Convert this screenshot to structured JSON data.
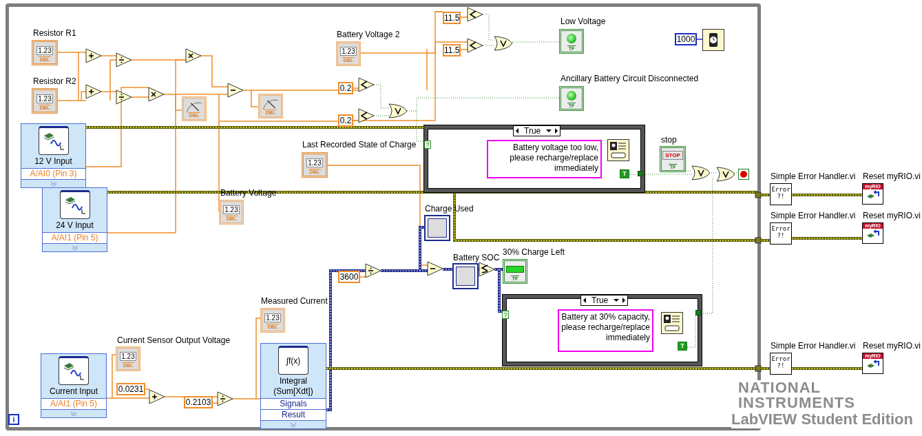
{
  "loop": {
    "iteration_terminal": "i"
  },
  "numeric_controls": [
    {
      "label": "Resistor R1",
      "value": "1.23",
      "type": "DBL"
    },
    {
      "label": "Resistor R2",
      "value": "1.23",
      "type": "DBL"
    },
    {
      "label": "Last Recorded State of Charge",
      "value": "1.23",
      "type": "DBL"
    }
  ],
  "numeric_indicators": [
    {
      "label": "Battery Voltage 2",
      "value": "1.23",
      "type": "DBL"
    },
    {
      "label": "Battery Voltage",
      "value": "1.23",
      "type": "DBL"
    },
    {
      "label": "Measured Current",
      "value": "1.23",
      "type": "DBL"
    },
    {
      "label": "Current Sensor Output Voltage",
      "value": "1.23",
      "type": "DBL"
    }
  ],
  "gauges": [
    {
      "type": "DBL"
    },
    {
      "type": "DBL"
    }
  ],
  "constants": [
    {
      "value": "11.5",
      "kind": "numeric"
    },
    {
      "value": "11.5",
      "kind": "numeric"
    },
    {
      "value": "0.2",
      "kind": "numeric"
    },
    {
      "value": "0.2",
      "kind": "numeric"
    },
    {
      "value": "0.0231",
      "kind": "numeric"
    },
    {
      "value": "0.2103",
      "kind": "numeric"
    },
    {
      "value": "3600",
      "kind": "numeric"
    },
    {
      "value": "1000",
      "kind": "integer"
    }
  ],
  "boolean_indicators": [
    {
      "label": "Low Voltage",
      "kind": "led",
      "type": "TF"
    },
    {
      "label": "Ancillary Battery Circuit Disconnected",
      "kind": "led",
      "type": "TF"
    },
    {
      "label": "30% Charge Left",
      "kind": "bar",
      "type": "TF"
    }
  ],
  "stop_button": {
    "label": "stop",
    "caption": "STOP",
    "type": "TF"
  },
  "express_vis": [
    {
      "title": "12 V Input",
      "kind": "analog",
      "terminals": [
        "A/AI0 (Pin 3)"
      ]
    },
    {
      "title": "24 V Input",
      "kind": "analog",
      "terminals": [
        "A/AI1 (Pin 5)"
      ]
    },
    {
      "title": "Current Input",
      "kind": "analog",
      "terminals": [
        "A/AI1 (Pin 5)"
      ]
    },
    {
      "title": "Integral (Sum[Xdt])",
      "kind": "integral",
      "icon_text": "∫f(x)",
      "terminals": [
        "Signals",
        "Result"
      ]
    }
  ],
  "case_structures": [
    {
      "selector": "True",
      "selector_terminal": "?",
      "message_lines": [
        "Battery voltage too low,",
        "please recharge/replace",
        "immediately"
      ],
      "constant": "T"
    },
    {
      "selector": "True",
      "selector_terminal": "?",
      "message_lines": [
        "Battery at 30% capacity,",
        "please recharge/replace",
        "immediately"
      ],
      "constant": "T"
    }
  ],
  "arrays": [
    {
      "label": "Charge Used"
    },
    {
      "label": "Battery SOC"
    }
  ],
  "functions": [
    {
      "kind": "add"
    },
    {
      "kind": "divide"
    },
    {
      "kind": "add"
    },
    {
      "kind": "divide"
    },
    {
      "kind": "multiply"
    },
    {
      "kind": "multiply"
    },
    {
      "kind": "subtract"
    },
    {
      "kind": "less"
    },
    {
      "kind": "less"
    },
    {
      "kind": "or"
    },
    {
      "kind": "less"
    },
    {
      "kind": "less"
    },
    {
      "kind": "or"
    },
    {
      "kind": "or"
    },
    {
      "kind": "or"
    },
    {
      "kind": "add"
    },
    {
      "kind": "divide"
    },
    {
      "kind": "divide"
    },
    {
      "kind": "subtract"
    },
    {
      "kind": "less_equal"
    }
  ],
  "error_handlers": [
    {
      "label": "Simple Error Handler.vi",
      "icon_lines": [
        "Error",
        "?!"
      ],
      "reset_label": "Reset myRIO.vi",
      "reset_header": "myRIO"
    },
    {
      "label": "Simple Error Handler.vi",
      "icon_lines": [
        "Error",
        "?!"
      ],
      "reset_label": "Reset myRIO.vi",
      "reset_header": "myRIO"
    },
    {
      "label": "Simple Error Handler.vi",
      "icon_lines": [
        "Error",
        "?!"
      ],
      "reset_label": "Reset myRIO.vi",
      "reset_header": "myRIO"
    }
  ],
  "watermark": {
    "brand_lines": [
      "NATIONAL",
      "INSTRUMENTS"
    ],
    "edition": "LabVIEW Student Edition"
  }
}
